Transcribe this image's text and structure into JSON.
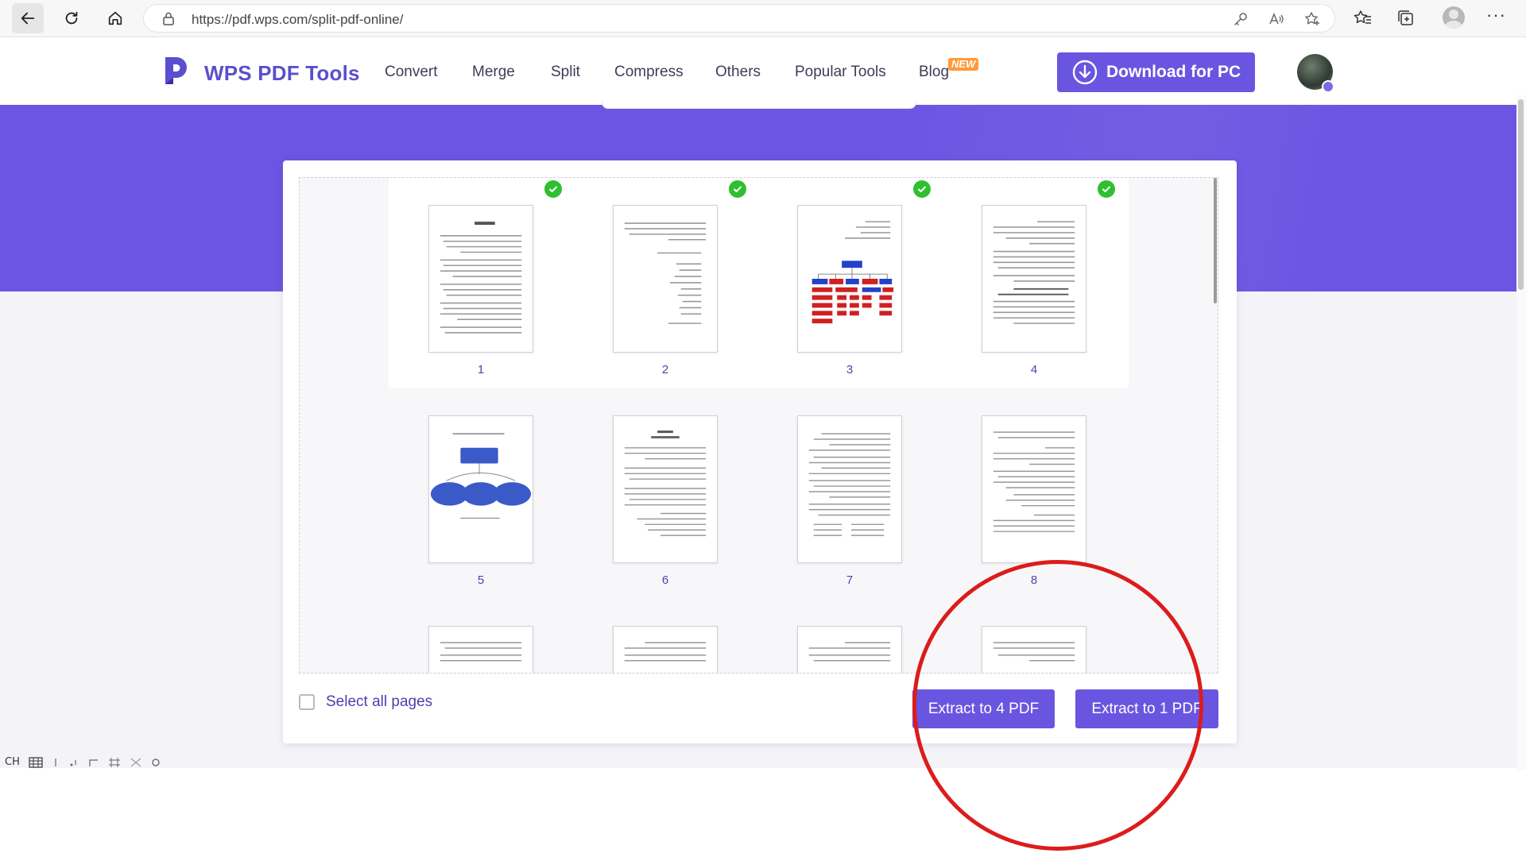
{
  "browser": {
    "url": "https://pdf.wps.com/split-pdf-online/"
  },
  "header": {
    "logo_text": "WPS PDF Tools",
    "nav": [
      "Convert",
      "Merge",
      "Split",
      "Compress",
      "Others",
      "Popular Tools",
      "Blog"
    ],
    "new_badge": "NEW",
    "download_label": "Download for PC"
  },
  "pages": [
    {
      "number": "1",
      "selected": true
    },
    {
      "number": "2",
      "selected": true
    },
    {
      "number": "3",
      "selected": true
    },
    {
      "number": "4",
      "selected": true
    },
    {
      "number": "5",
      "selected": false
    },
    {
      "number": "6",
      "selected": false
    },
    {
      "number": "7",
      "selected": false
    },
    {
      "number": "8",
      "selected": false
    }
  ],
  "footer": {
    "select_all_label": "Select all pages",
    "extract_selected_label": "Extract to 4 PDF",
    "extract_one_label": "Extract to 1 PDF"
  },
  "ime": {
    "mode": "CH"
  },
  "colors": {
    "brand": "#6a55e0",
    "check": "#2fbf2f",
    "annotation": "#dc1c1c"
  }
}
